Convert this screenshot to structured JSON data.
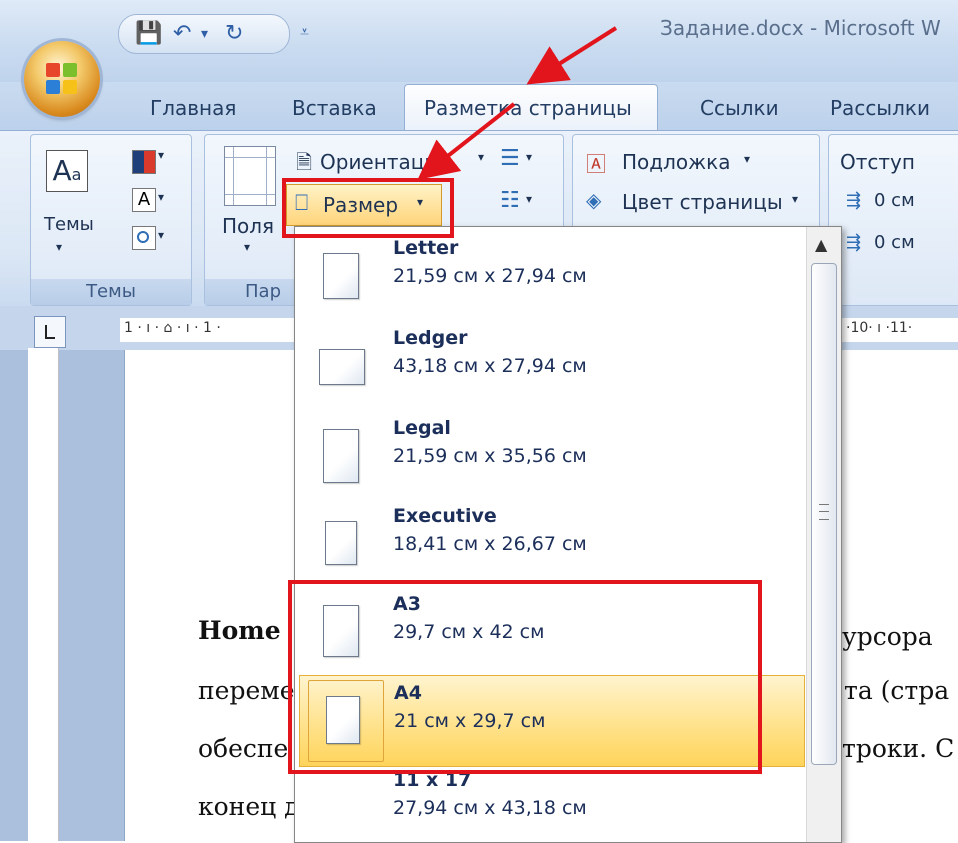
{
  "title_bar": {
    "title": "Задание.docx - Microsoft W"
  },
  "tabs": [
    {
      "label": "Главная"
    },
    {
      "label": "Вставка"
    },
    {
      "label": "Разметка страницы"
    },
    {
      "label": "Ссылки"
    },
    {
      "label": "Рассылки"
    }
  ],
  "ribbon": {
    "themes_group": {
      "themes_label": "Темы",
      "group_label": "Темы"
    },
    "page_setup_group": {
      "fields_label": "Поля",
      "orientation_label": "Ориентация",
      "size_label": "Размер",
      "group_label": "Пар"
    },
    "page_background_group": {
      "watermark_label": "Подложка",
      "page_color_label": "Цвет страницы"
    },
    "paragraph_group": {
      "indent_label": "Отступ",
      "indent_left_value": "0 см",
      "indent_right_value": "0 см"
    }
  },
  "ruler": {
    "left_marks": "1 · ı · ⌂ · ı · 1 ·",
    "right_marks": "·10· ı ·11·"
  },
  "document": {
    "line1_bold": "Home",
    "line1_tail": "урсора",
    "line2_head": "переме",
    "line2_tail": "та (стра",
    "line3_head": "обеспе",
    "line3_tail": "троки. С",
    "line4_head": "конец д"
  },
  "size_dropdown": {
    "items": [
      {
        "name": "Letter",
        "dims": "21,59 см x 27,94 см"
      },
      {
        "name": "Ledger",
        "dims": "43,18 см x 27,94 см"
      },
      {
        "name": "Legal",
        "dims": "21,59 см x 35,56 см"
      },
      {
        "name": "Executive",
        "dims": "18,41 см x 26,67 см"
      },
      {
        "name": "A3",
        "dims": "29,7 см x 42 см"
      },
      {
        "name": "A4",
        "dims": "21 см x 29,7 см"
      },
      {
        "name": "11 x 17",
        "dims": "27,94 см x 43,18 см"
      }
    ],
    "selected": "A4"
  },
  "colors": {
    "annotation_red": "#e2141c",
    "selection_gold": "#ffd45a",
    "ribbon_blue": "#c9dbf0"
  }
}
